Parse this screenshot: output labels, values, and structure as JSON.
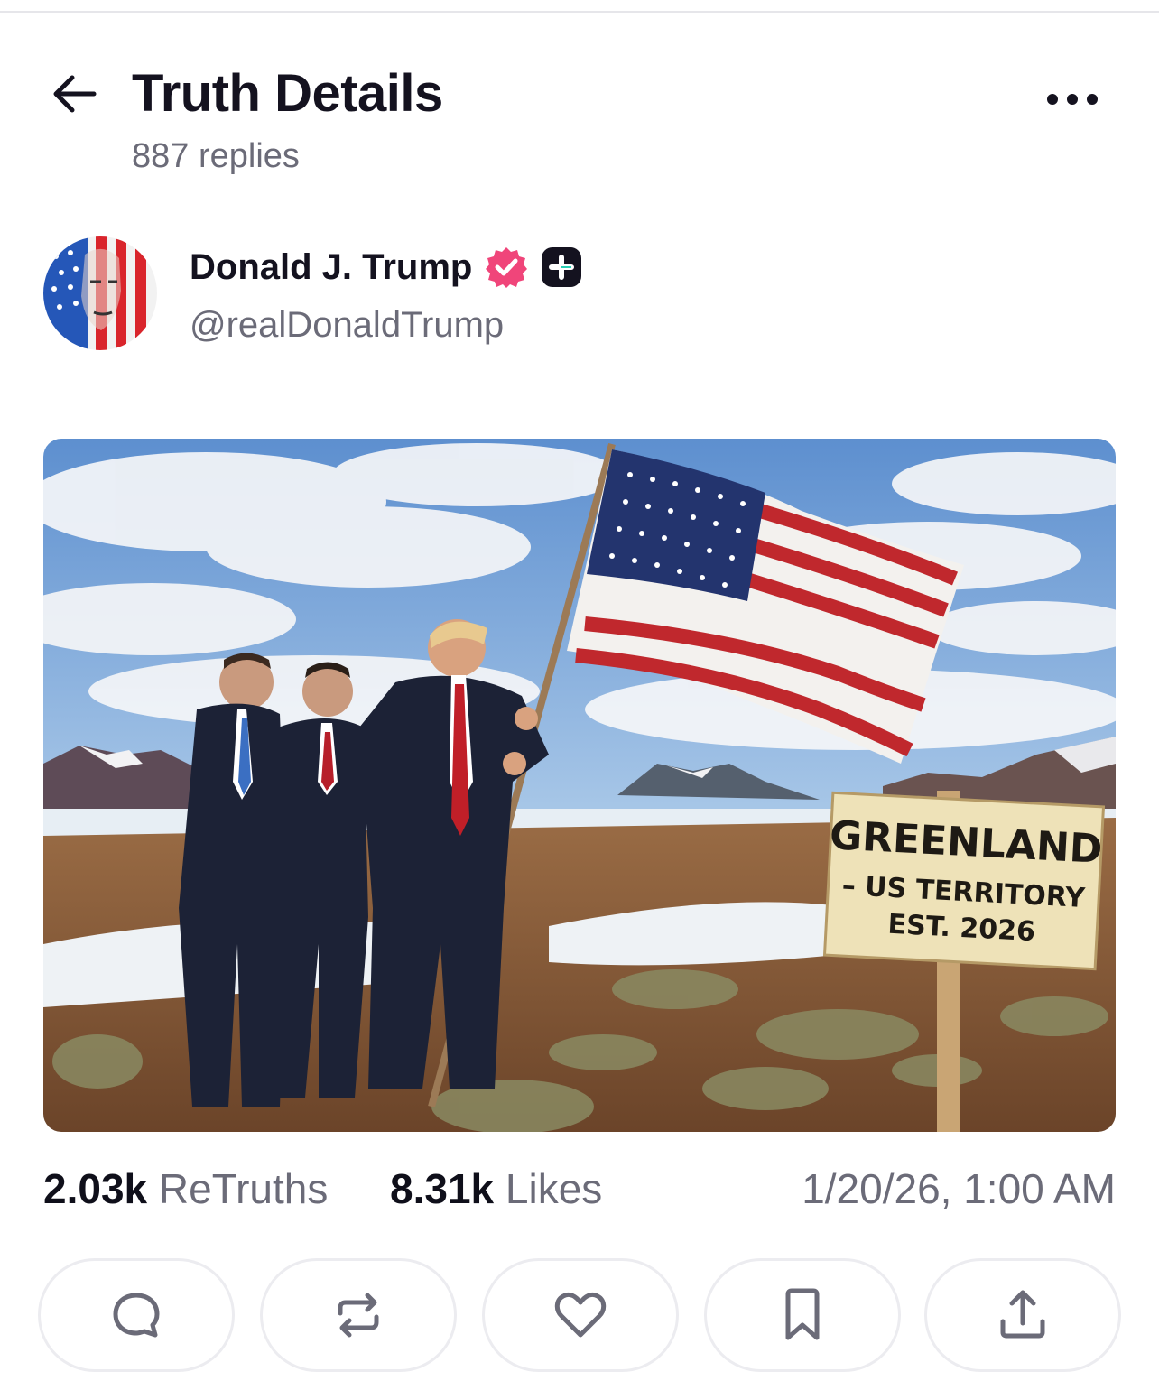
{
  "header": {
    "title": "Truth Details",
    "subtitle": "887 replies",
    "back_icon": "arrow-left-icon",
    "more_icon": "more-horizontal-icon"
  },
  "author": {
    "name": "Donald J. Trump",
    "handle": "@realDonaldTrump",
    "verified_icon": "verified-badge-icon",
    "plus_icon": "truth-plus-icon",
    "verified_color": "#f0457a"
  },
  "post": {
    "sign": {
      "line1": "GREENLAND",
      "line2": "– US TERRITORY",
      "line3": "EST. 2026"
    }
  },
  "stats": {
    "retruths_count": "2.03k",
    "retruths_label": "ReTruths",
    "likes_count": "8.31k",
    "likes_label": "Likes",
    "timestamp": "1/20/26, 1:00 AM"
  },
  "actions": [
    {
      "name": "reply",
      "icon": "reply-bubble-icon"
    },
    {
      "name": "retruth",
      "icon": "repost-icon"
    },
    {
      "name": "like",
      "icon": "heart-icon"
    },
    {
      "name": "bookmark",
      "icon": "bookmark-icon"
    },
    {
      "name": "share",
      "icon": "share-icon"
    }
  ]
}
